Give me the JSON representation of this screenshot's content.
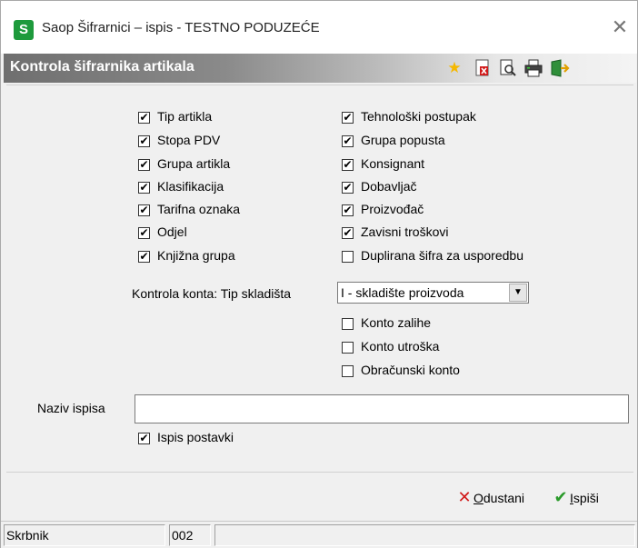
{
  "window": {
    "title": "Saop Šifrarnici – ispis - TESTNO PODUZEĆE",
    "app_icon_letter": "S",
    "close_glyph": "✕"
  },
  "header": {
    "title": "Kontrola šifrarnika artikala",
    "toolbar_icons": [
      "star-icon",
      "pdf-icon",
      "print-preview-icon",
      "printer-icon",
      "exit-icon"
    ]
  },
  "left_checks": [
    {
      "label": "Tip artikla",
      "checked": true
    },
    {
      "label": "Stopa PDV",
      "checked": true
    },
    {
      "label": "Grupa artikla",
      "checked": true
    },
    {
      "label": "Klasifikacija",
      "checked": true
    },
    {
      "label": "Tarifna oznaka",
      "checked": true
    },
    {
      "label": "Odjel",
      "checked": true
    },
    {
      "label": "Knjižna grupa",
      "checked": true
    }
  ],
  "right_checks": [
    {
      "label": "Tehnološki postupak",
      "checked": true
    },
    {
      "label": "Grupa popusta",
      "checked": true
    },
    {
      "label": "Konsignant",
      "checked": true
    },
    {
      "label": "Dobavljač",
      "checked": true
    },
    {
      "label": "Proizvođač",
      "checked": true
    },
    {
      "label": "Zavisni troškovi",
      "checked": true
    },
    {
      "label": "Duplirana šifra za usporedbu",
      "checked": false
    }
  ],
  "konto": {
    "label": "Kontrola konta: Tip skladišta",
    "selected": "I - skladište proizvoda",
    "checks": [
      {
        "label": "Konto zalihe",
        "checked": false
      },
      {
        "label": "Konto utroška",
        "checked": false
      },
      {
        "label": "Obračunski konto",
        "checked": false
      }
    ]
  },
  "naziv": {
    "label": "Naziv ispisa",
    "value": ""
  },
  "ispis_postavki": {
    "label": "Ispis postavki",
    "checked": true
  },
  "buttons": {
    "cancel_label": "Odustani",
    "cancel_mnemonic": "O",
    "cancel_rest": "dustani",
    "print_label": "Ispiši",
    "print_mnemonic": "I",
    "print_rest": "spiši"
  },
  "status": {
    "user": "Skrbnik",
    "code": "002",
    "extra": ""
  },
  "colors": {
    "app_icon": "#1e9a3c",
    "cancel_x": "#d11a1a",
    "print_check": "#2a9a2a"
  }
}
